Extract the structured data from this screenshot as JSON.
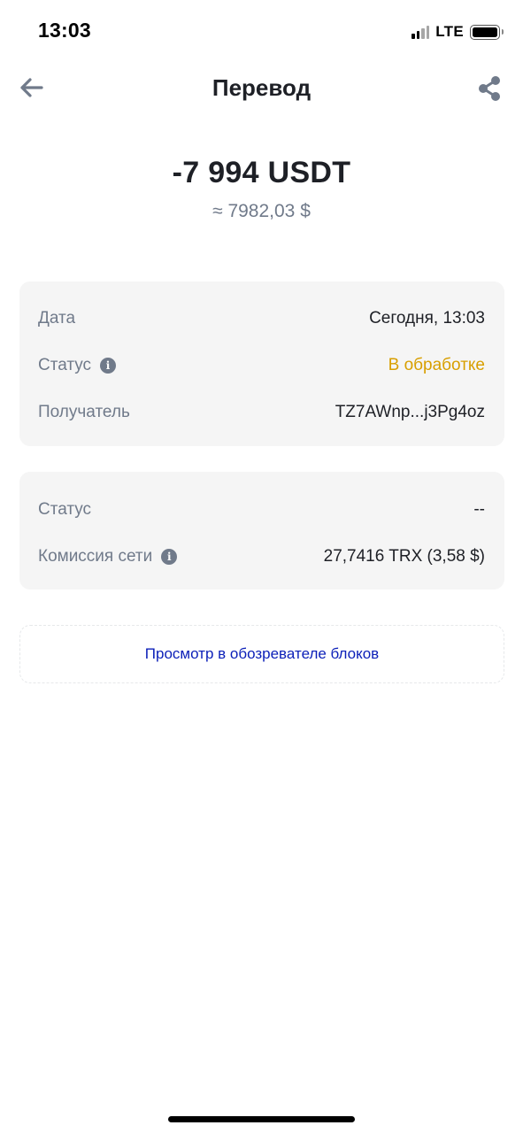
{
  "status_bar": {
    "time": "13:03",
    "network": "LTE",
    "icons": [
      "signal-icon",
      "battery-icon"
    ]
  },
  "header": {
    "title": "Перевод",
    "back_icon": "arrow-left-icon",
    "share_icon": "share-icon"
  },
  "amount": {
    "main": "-7 994 USDT",
    "fiat": "≈ 7982,03 $"
  },
  "details": [
    {
      "label": "Дата",
      "value": "Сегодня, 13:03",
      "info": false
    },
    {
      "label": "Статус",
      "value": "В обработке",
      "info": true,
      "value_color": "#d89f00"
    },
    {
      "label": "Получатель",
      "value": "TZ7AWnp...j3Pg4oz",
      "info": false
    }
  ],
  "network_details": [
    {
      "label": "Статус",
      "value": "--",
      "info": false
    },
    {
      "label": "Комиссия сети",
      "value": "27,7416 TRX (3,58 $)",
      "info": true
    }
  ],
  "explorer": {
    "label": "Просмотр в обозревателе блоков",
    "color": "#0b1fb8"
  },
  "colors": {
    "text_primary": "#1e2026",
    "text_secondary": "#707a8a",
    "card_bg": "#f5f5f5",
    "pending": "#d89f00",
    "link": "#0b1fb8"
  }
}
